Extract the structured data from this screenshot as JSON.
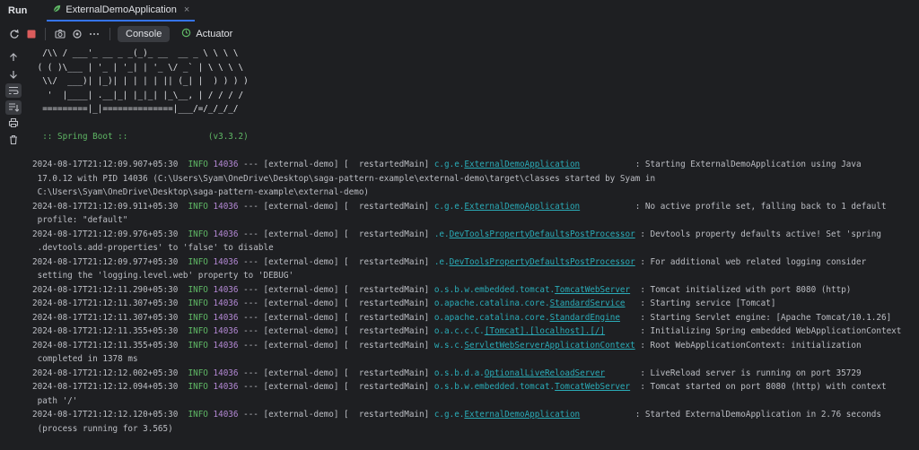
{
  "header": {
    "run_label": "Run",
    "tab_label": "ExternalDemoApplication",
    "close_glyph": "×"
  },
  "toolbar": {
    "console_label": "Console",
    "actuator_label": "Actuator"
  },
  "console": {
    "banner": [
      "  /\\\\ / ___'_ __ _ _(_)_ __  __ _ \\ \\ \\ \\",
      " ( ( )\\___ | '_ | '_| | '_ \\/ _` | \\ \\ \\ \\",
      "  \\\\/  ___)| |_)| | | | | || (_| |  ) ) ) )",
      "   '  |____| .__|_| |_|_| |_\\__, | / / / /",
      "  =========|_|==============|___/=/_/_/_/"
    ],
    "spring_boot": "  :: Spring Boot ::                (v3.3.2)",
    "logs": [
      {
        "ts": "2024-08-17T21:12:09.907+05:30",
        "level": "INFO",
        "pid": "14036",
        "mid": "--- [external-demo] [  restartedMain]",
        "logger_pre": "c.g.e.",
        "logger_u": "ExternalDemoApplication",
        "pad": "           ",
        "msg": ": Starting ExternalDemoApplication using Java",
        "cont": [
          "17.0.12 with PID 14036 (C:\\Users\\Syam\\OneDrive\\Desktop\\saga-pattern-example\\external-demo\\target\\classes started by Syam in",
          "C:\\Users\\Syam\\OneDrive\\Desktop\\saga-pattern-example\\external-demo)"
        ]
      },
      {
        "ts": "2024-08-17T21:12:09.911+05:30",
        "level": "INFO",
        "pid": "14036",
        "mid": "--- [external-demo] [  restartedMain]",
        "logger_pre": "c.g.e.",
        "logger_u": "ExternalDemoApplication",
        "pad": "           ",
        "msg": ": No active profile set, falling back to 1 default",
        "cont": [
          "profile: \"default\""
        ]
      },
      {
        "ts": "2024-08-17T21:12:09.976+05:30",
        "level": "INFO",
        "pid": "14036",
        "mid": "--- [external-demo] [  restartedMain]",
        "logger_pre": ".e.",
        "logger_u": "DevToolsPropertyDefaultsPostProcessor",
        "pad": " ",
        "msg": ": Devtools property defaults active! Set 'spring",
        "cont": [
          ".devtools.add-properties' to 'false' to disable"
        ]
      },
      {
        "ts": "2024-08-17T21:12:09.977+05:30",
        "level": "INFO",
        "pid": "14036",
        "mid": "--- [external-demo] [  restartedMain]",
        "logger_pre": ".e.",
        "logger_u": "DevToolsPropertyDefaultsPostProcessor",
        "pad": " ",
        "msg": ": For additional web related logging consider",
        "cont": [
          "setting the 'logging.level.web' property to 'DEBUG'"
        ]
      },
      {
        "ts": "2024-08-17T21:12:11.290+05:30",
        "level": "INFO",
        "pid": "14036",
        "mid": "--- [external-demo] [  restartedMain]",
        "logger_pre": "o.s.b.w.embedded.tomcat.",
        "logger_u": "TomcatWebServer",
        "pad": "  ",
        "msg": ": Tomcat initialized with port 8080 (http)",
        "cont": []
      },
      {
        "ts": "2024-08-17T21:12:11.307+05:30",
        "level": "INFO",
        "pid": "14036",
        "mid": "--- [external-demo] [  restartedMain]",
        "logger_pre": "o.apache.catalina.core.",
        "logger_u": "StandardService",
        "pad": "   ",
        "msg": ": Starting service [Tomcat]",
        "cont": []
      },
      {
        "ts": "2024-08-17T21:12:11.307+05:30",
        "level": "INFO",
        "pid": "14036",
        "mid": "--- [external-demo] [  restartedMain]",
        "logger_pre": "o.apache.catalina.core.",
        "logger_u": "StandardEngine",
        "pad": "    ",
        "msg": ": Starting Servlet engine: [Apache Tomcat/10.1.26]",
        "cont": []
      },
      {
        "ts": "2024-08-17T21:12:11.355+05:30",
        "level": "INFO",
        "pid": "14036",
        "mid": "--- [external-demo] [  restartedMain]",
        "logger_pre": "o.a.c.c.C.",
        "logger_u": "[Tomcat].[localhost].[/]",
        "pad": "       ",
        "msg": ": Initializing Spring embedded WebApplicationContext",
        "cont": []
      },
      {
        "ts": "2024-08-17T21:12:11.355+05:30",
        "level": "INFO",
        "pid": "14036",
        "mid": "--- [external-demo] [  restartedMain]",
        "logger_pre": "w.s.c.",
        "logger_u": "ServletWebServerApplicationContext",
        "pad": " ",
        "msg": ": Root WebApplicationContext: initialization",
        "cont": [
          "completed in 1378 ms"
        ]
      },
      {
        "ts": "2024-08-17T21:12:12.002+05:30",
        "level": "INFO",
        "pid": "14036",
        "mid": "--- [external-demo] [  restartedMain]",
        "logger_pre": "o.s.b.d.a.",
        "logger_u": "OptionalLiveReloadServer",
        "pad": "       ",
        "msg": ": LiveReload server is running on port 35729",
        "cont": []
      },
      {
        "ts": "2024-08-17T21:12:12.094+05:30",
        "level": "INFO",
        "pid": "14036",
        "mid": "--- [external-demo] [  restartedMain]",
        "logger_pre": "o.s.b.w.embedded.tomcat.",
        "logger_u": "TomcatWebServer",
        "pad": "  ",
        "msg": ": Tomcat started on port 8080 (http) with context",
        "cont": [
          "path '/'"
        ]
      },
      {
        "ts": "2024-08-17T21:12:12.120+05:30",
        "level": "INFO",
        "pid": "14036",
        "mid": "--- [external-demo] [  restartedMain]",
        "logger_pre": "c.g.e.",
        "logger_u": "ExternalDemoApplication",
        "pad": "           ",
        "msg": ": Started ExternalDemoApplication in 2.76 seconds",
        "cont": [
          "(process running for 3.565)"
        ]
      }
    ]
  },
  "icons": {
    "rerun": "rerun-icon",
    "stop": "stop-icon",
    "screenshot": "camera-icon",
    "settings": "settings-icon",
    "more": "more-icon",
    "up": "arrow-up-icon",
    "down": "arrow-down-icon",
    "wrap": "soft-wrap-icon",
    "scroll": "scroll-to-end-icon",
    "print": "print-icon",
    "clear": "trash-icon",
    "leaf": "spring-leaf-icon"
  },
  "colors": {
    "background": "#1e1f22",
    "info": "#5fb865",
    "pid": "#b589d6",
    "logger": "#2aacb8",
    "accent": "#3574f0",
    "stop": "#db5c5c"
  }
}
